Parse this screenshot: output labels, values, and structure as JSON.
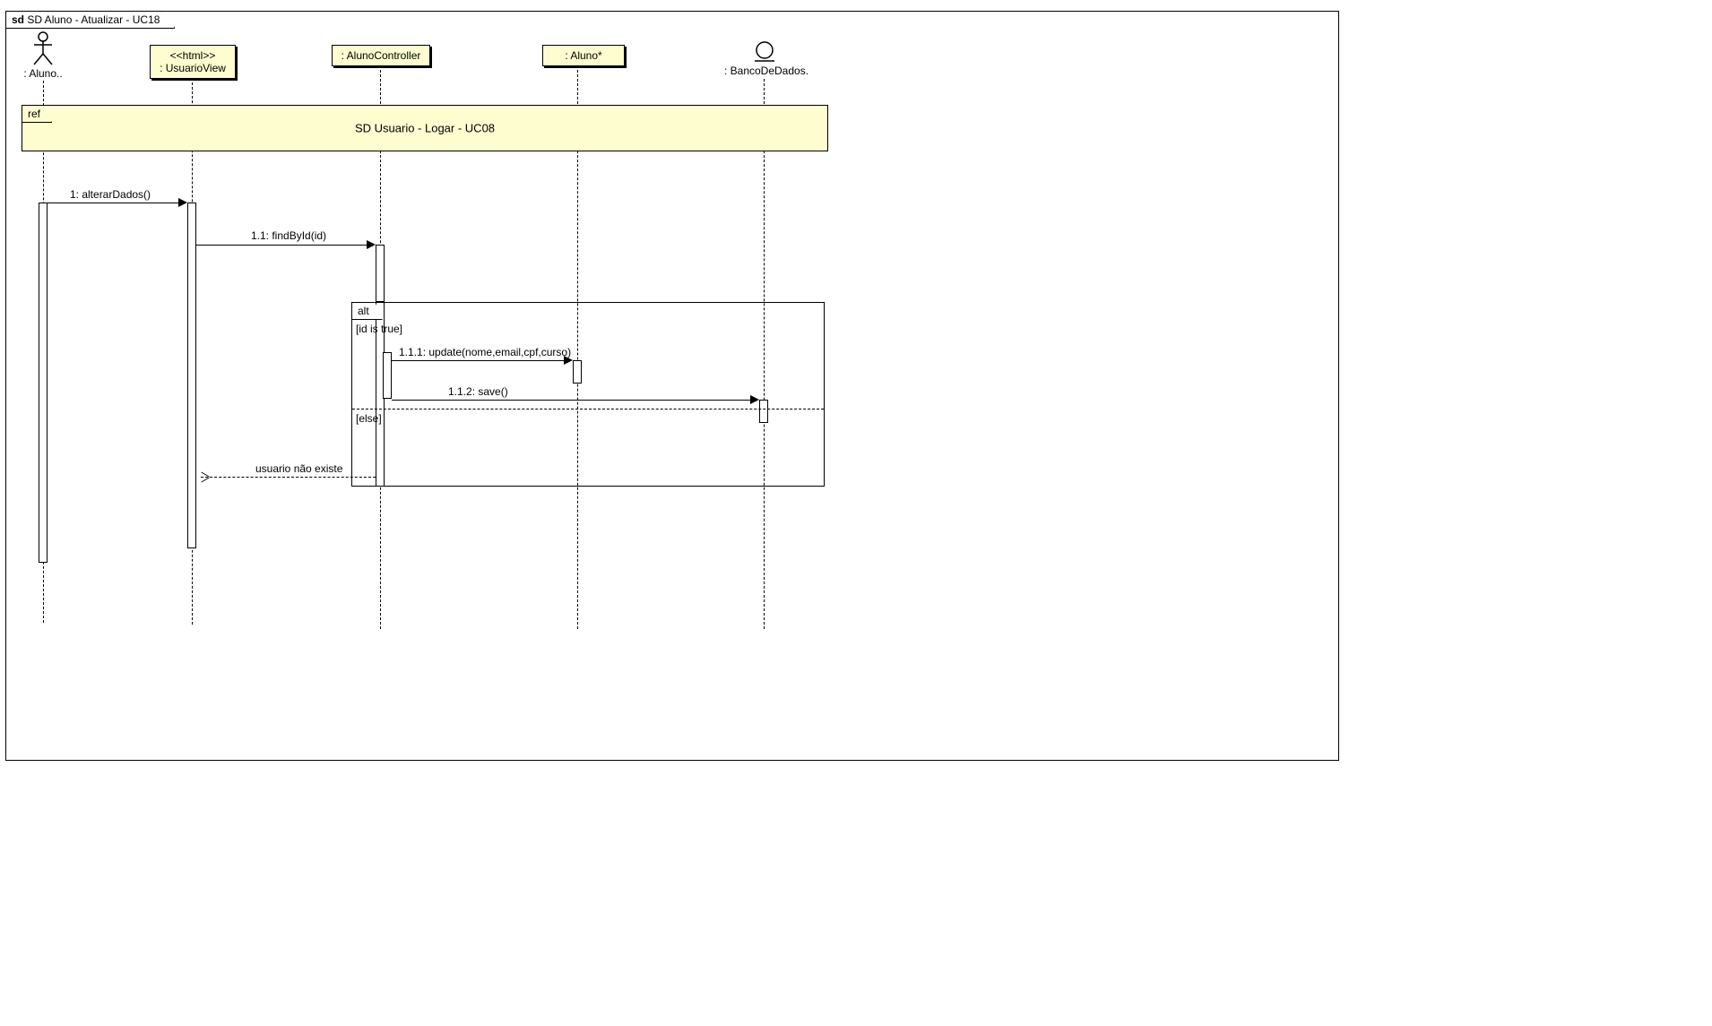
{
  "frame": {
    "prefix": "sd ",
    "title": "SD Aluno - Atualizar - UC18"
  },
  "lifelines": {
    "actor": {
      "label": ": Aluno.."
    },
    "view": {
      "stereotype": "<<html>>",
      "label": ": UsuarioView"
    },
    "controller": {
      "label": ": AlunoController"
    },
    "model": {
      "label": ": Aluno*"
    },
    "db": {
      "label": ": BancoDeDados."
    }
  },
  "ref": {
    "tag": "ref",
    "title": "SD Usuario - Logar - UC08"
  },
  "messages": {
    "m1": "1: alterarDados()",
    "m11": "1.1: findById(id)",
    "m111": "1.1.1: update(nome,email,cpf,curso)",
    "m112": "1.1.2: save()",
    "ret": "usuario não existe"
  },
  "alt": {
    "tag": "alt",
    "guard_true": "[id is true]",
    "guard_else": "[else]"
  }
}
